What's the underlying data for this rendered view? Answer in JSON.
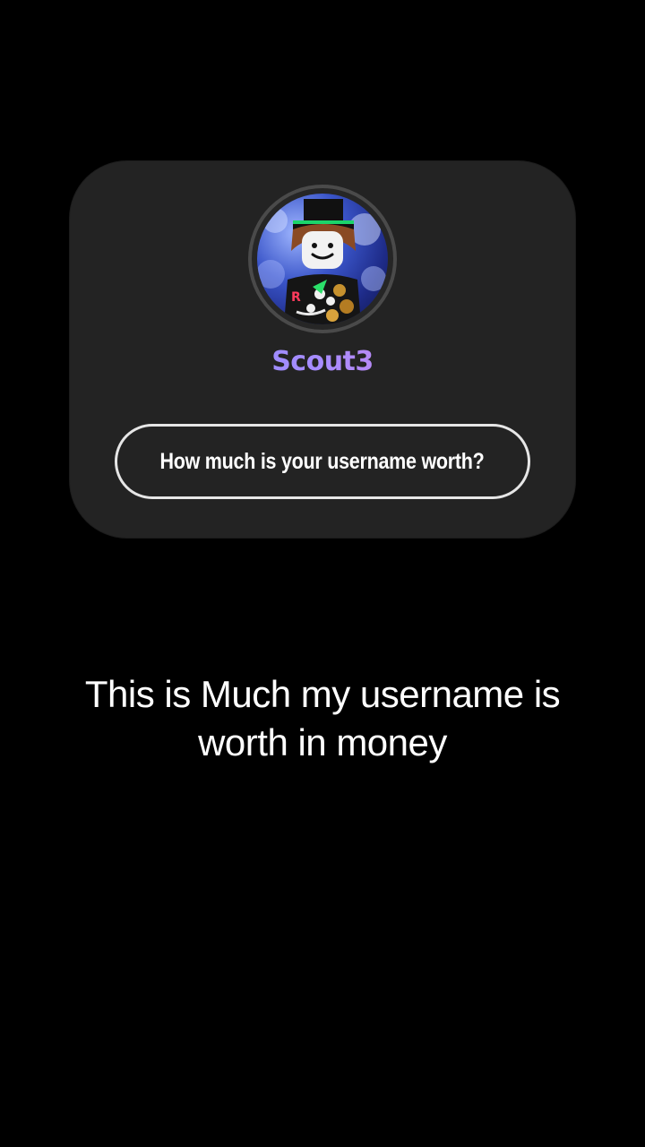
{
  "profile": {
    "username": "Scout3",
    "avatar_icon": "roblox-avatar-image"
  },
  "question_button": {
    "label": "How much is your username worth?"
  },
  "caption": {
    "text": "This is Much my username is worth in money"
  },
  "colors": {
    "background": "#000000",
    "card": "#232323",
    "username_gradient_start": "#6d8bff",
    "username_gradient_end": "#ff7dc1",
    "button_border": "#e6e6e6"
  }
}
